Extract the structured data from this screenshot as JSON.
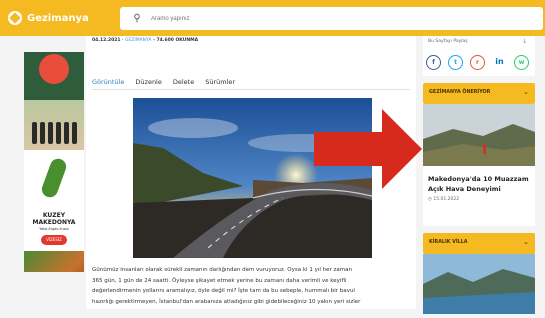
{
  "brand": {
    "name": "Gezimanya",
    "color": "#f5b921"
  },
  "search": {
    "placeholder": "Aramo yapınız",
    "icon": "search-icon"
  },
  "article": {
    "date": "04.12.2021",
    "separator": " - ",
    "category": "GEZIMANYA",
    "reads": " - 74.600 OKUNMA",
    "tabs": [
      "Görüntüle",
      "Düzenle",
      "Delete",
      "Sürümler"
    ],
    "active_tab": "Görüntüle",
    "body_lines": [
      "Günümüz insanları olarak sürekli zamanın darlığından dem vuruyoruz. Oysa ki 1 yıl her zaman",
      "365 gün, 1 gün de 24 saatti. Öyleyse şikayet etmek yerine bu zamanı daha verimli ve keyifli",
      "değerlendirmenin yollarını aramalıyız, öyle değil mi? İşte tam da bu sebeple, hummalı bir bavul",
      "hazırlığı gerektirmeyen, İstanbul'dan arabanıza atladığınız gibi gidebileceğiniz 10 yakın yeri sizler"
    ]
  },
  "left_ad": {
    "title_line1": "KUZEY",
    "title_line2": "MAKEDONYA",
    "subtitle": "Yaka-Ergas-Ilusia",
    "stamp": "VİZESİZ"
  },
  "sidebar": {
    "share": {
      "label": "Bu Sayfayı Paylaş",
      "chevron": "chevron-down-icon",
      "icons": [
        {
          "name": "facebook-icon",
          "glyph": "f",
          "color": "#3b5998"
        },
        {
          "name": "twitter-icon",
          "glyph": "t",
          "color": "#1da1f2"
        },
        {
          "name": "reddit-icon",
          "glyph": "r",
          "color": "#e05a2a"
        },
        {
          "name": "linkedin-icon",
          "glyph": "in",
          "color": "#0077b5"
        },
        {
          "name": "whatsapp-icon",
          "glyph": "w",
          "color": "#25d366"
        }
      ]
    },
    "recommended": {
      "heading": "GEZİMANYA ÖNERİYOR",
      "card_title": "Makedonya'da 10 Muazzam Açık Hava Deneyimi",
      "card_date": "15.01.2022"
    },
    "rentals": {
      "heading": "KİRALIK VİLLA"
    }
  },
  "annotation": {
    "arrow_color": "#d62a1d"
  }
}
